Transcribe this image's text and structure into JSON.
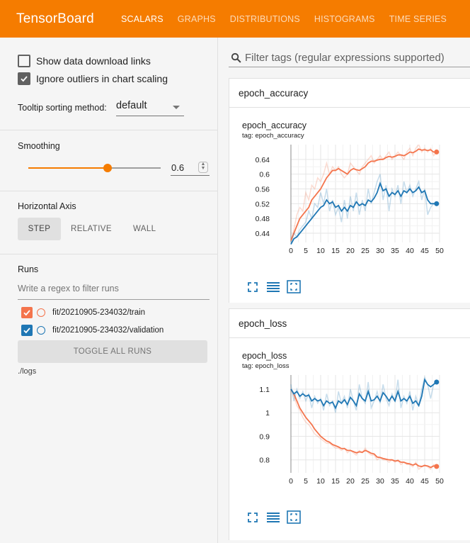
{
  "header": {
    "title": "TensorBoard",
    "tabs": [
      {
        "label": "SCALARS",
        "active": true
      },
      {
        "label": "GRAPHS",
        "active": false
      },
      {
        "label": "DISTRIBUTIONS",
        "active": false
      },
      {
        "label": "HISTOGRAMS",
        "active": false
      },
      {
        "label": "TIME SERIES",
        "active": false
      }
    ],
    "color": "#f57c00"
  },
  "sidebar": {
    "show_download": {
      "label": "Show data download links",
      "checked": false
    },
    "ignore_outliers": {
      "label": "Ignore outliers in chart scaling",
      "checked": true
    },
    "tooltip_sorting": {
      "label": "Tooltip sorting method:",
      "value": "default"
    },
    "smoothing": {
      "label": "Smoothing",
      "value": "0.6",
      "fraction": 0.6
    },
    "horizontal_axis": {
      "label": "Horizontal Axis",
      "options": [
        "STEP",
        "RELATIVE",
        "WALL"
      ],
      "selected": "STEP"
    },
    "runs": {
      "label": "Runs",
      "filter_placeholder": "Write a regex to filter runs",
      "items": [
        {
          "name": "fit/20210905-234032/train",
          "checked": true,
          "color": "#f4744c"
        },
        {
          "name": "fit/20210905-234032/validation",
          "checked": true,
          "color": "#1f77b4"
        }
      ],
      "toggle_label": "TOGGLE ALL RUNS",
      "logdir": "./logs"
    }
  },
  "main": {
    "filter_placeholder": "Filter tags (regular expressions supported)"
  },
  "chart_data": [
    {
      "type": "line",
      "group": "epoch_accuracy",
      "title": "epoch_accuracy",
      "subtitle": "tag: epoch_accuracy",
      "xlim": [
        0,
        50
      ],
      "ylim": [
        0.415,
        0.68
      ],
      "xticks": [
        "0",
        "5",
        "10",
        "15",
        "20",
        "25",
        "30",
        "35",
        "40",
        "45",
        "50"
      ],
      "yticks": [
        "0.44",
        "0.48",
        "0.52",
        "0.56",
        "0.6",
        "0.64"
      ],
      "ytick_values": [
        0.44,
        0.48,
        0.52,
        0.56,
        0.6,
        0.64
      ],
      "grid": true,
      "series": [
        {
          "color": "#f4744c",
          "x": [
            0,
            1,
            2,
            3,
            4,
            5,
            6,
            7,
            8,
            9,
            10,
            11,
            12,
            13,
            14,
            15,
            16,
            17,
            18,
            19,
            20,
            21,
            22,
            23,
            24,
            25,
            26,
            27,
            28,
            29,
            30,
            31,
            32,
            33,
            34,
            35,
            36,
            37,
            38,
            39,
            40,
            41,
            42,
            43,
            44,
            45,
            46,
            47,
            48,
            49
          ],
          "raw": [
            0.42,
            0.45,
            0.49,
            0.51,
            0.5,
            0.55,
            0.53,
            0.57,
            0.56,
            0.59,
            0.58,
            0.6,
            0.63,
            0.6,
            0.62,
            0.61,
            0.62,
            0.6,
            0.59,
            0.6,
            0.63,
            0.62,
            0.61,
            0.6,
            0.62,
            0.63,
            0.64,
            0.65,
            0.63,
            0.64,
            0.65,
            0.64,
            0.65,
            0.66,
            0.64,
            0.65,
            0.66,
            0.65,
            0.64,
            0.66,
            0.67,
            0.65,
            0.67,
            0.68,
            0.66,
            0.67,
            0.66,
            0.67,
            0.65,
            0.66
          ],
          "smoothed": [
            0.42,
            0.44,
            0.46,
            0.48,
            0.49,
            0.5,
            0.51,
            0.53,
            0.54,
            0.55,
            0.56,
            0.575,
            0.59,
            0.6,
            0.61,
            0.61,
            0.615,
            0.61,
            0.605,
            0.6,
            0.61,
            0.615,
            0.612,
            0.61,
            0.615,
            0.62,
            0.63,
            0.635,
            0.635,
            0.638,
            0.64,
            0.64,
            0.645,
            0.648,
            0.646,
            0.648,
            0.652,
            0.652,
            0.65,
            0.654,
            0.66,
            0.658,
            0.662,
            0.668,
            0.665,
            0.666,
            0.664,
            0.666,
            0.66,
            0.66
          ]
        },
        {
          "color": "#1f77b4",
          "x": [
            0,
            1,
            2,
            3,
            4,
            5,
            6,
            7,
            8,
            9,
            10,
            11,
            12,
            13,
            14,
            15,
            16,
            17,
            18,
            19,
            20,
            21,
            22,
            23,
            24,
            25,
            26,
            27,
            28,
            29,
            30,
            31,
            32,
            33,
            34,
            35,
            36,
            37,
            38,
            39,
            40,
            41,
            42,
            43,
            44,
            45,
            46,
            47,
            48,
            49
          ],
          "raw": [
            0.41,
            0.44,
            0.43,
            0.45,
            0.46,
            0.47,
            0.5,
            0.48,
            0.52,
            0.51,
            0.55,
            0.52,
            0.56,
            0.5,
            0.53,
            0.49,
            0.51,
            0.47,
            0.53,
            0.48,
            0.54,
            0.5,
            0.55,
            0.49,
            0.53,
            0.5,
            0.56,
            0.52,
            0.55,
            0.58,
            0.6,
            0.53,
            0.57,
            0.5,
            0.56,
            0.54,
            0.57,
            0.52,
            0.58,
            0.55,
            0.57,
            0.54,
            0.56,
            0.58,
            0.53,
            0.56,
            0.49,
            0.51,
            0.52,
            0.52
          ],
          "smoothed": [
            0.41,
            0.425,
            0.43,
            0.44,
            0.45,
            0.46,
            0.47,
            0.48,
            0.49,
            0.5,
            0.51,
            0.515,
            0.53,
            0.52,
            0.525,
            0.51,
            0.515,
            0.5,
            0.51,
            0.5,
            0.515,
            0.51,
            0.525,
            0.515,
            0.52,
            0.515,
            0.53,
            0.525,
            0.535,
            0.55,
            0.575,
            0.555,
            0.56,
            0.54,
            0.55,
            0.545,
            0.555,
            0.54,
            0.555,
            0.55,
            0.56,
            0.55,
            0.555,
            0.565,
            0.55,
            0.555,
            0.53,
            0.52,
            0.52,
            0.52
          ]
        }
      ]
    },
    {
      "type": "line",
      "group": "epoch_loss",
      "title": "epoch_loss",
      "subtitle": "tag: epoch_loss",
      "xlim": [
        0,
        50
      ],
      "ylim": [
        0.745,
        1.16
      ],
      "xticks": [
        "0",
        "5",
        "10",
        "15",
        "20",
        "25",
        "30",
        "35",
        "40",
        "45",
        "50"
      ],
      "yticks": [
        "0.8",
        "0.9",
        "1",
        "1.1"
      ],
      "ytick_values": [
        0.8,
        0.9,
        1.0,
        1.1
      ],
      "grid": true,
      "series": [
        {
          "color": "#f4744c",
          "x": [
            0,
            1,
            2,
            3,
            4,
            5,
            6,
            7,
            8,
            9,
            10,
            11,
            12,
            13,
            14,
            15,
            16,
            17,
            18,
            19,
            20,
            21,
            22,
            23,
            24,
            25,
            26,
            27,
            28,
            29,
            30,
            31,
            32,
            33,
            34,
            35,
            36,
            37,
            38,
            39,
            40,
            41,
            42,
            43,
            44,
            45,
            46,
            47,
            48,
            49
          ],
          "raw": [
            1.1,
            1.07,
            1.03,
            1.01,
            0.98,
            0.96,
            0.95,
            0.93,
            0.91,
            0.9,
            0.89,
            0.88,
            0.87,
            0.87,
            0.86,
            0.85,
            0.85,
            0.84,
            0.85,
            0.83,
            0.84,
            0.83,
            0.82,
            0.84,
            0.83,
            0.85,
            0.83,
            0.82,
            0.82,
            0.8,
            0.81,
            0.8,
            0.8,
            0.79,
            0.8,
            0.79,
            0.8,
            0.78,
            0.79,
            0.78,
            0.78,
            0.77,
            0.79,
            0.76,
            0.77,
            0.78,
            0.77,
            0.76,
            0.78,
            0.77
          ],
          "smoothed": [
            1.1,
            1.08,
            1.05,
            1.02,
            1.0,
            0.98,
            0.965,
            0.95,
            0.93,
            0.915,
            0.9,
            0.89,
            0.88,
            0.875,
            0.865,
            0.86,
            0.855,
            0.848,
            0.848,
            0.84,
            0.84,
            0.835,
            0.83,
            0.834,
            0.832,
            0.84,
            0.835,
            0.828,
            0.825,
            0.812,
            0.81,
            0.806,
            0.803,
            0.8,
            0.8,
            0.795,
            0.797,
            0.79,
            0.79,
            0.785,
            0.783,
            0.778,
            0.783,
            0.774,
            0.772,
            0.776,
            0.774,
            0.768,
            0.774,
            0.772
          ]
        },
        {
          "color": "#1f77b4",
          "x": [
            0,
            1,
            2,
            3,
            4,
            5,
            6,
            7,
            8,
            9,
            10,
            11,
            12,
            13,
            14,
            15,
            16,
            17,
            18,
            19,
            20,
            21,
            22,
            23,
            24,
            25,
            26,
            27,
            28,
            29,
            30,
            31,
            32,
            33,
            34,
            35,
            36,
            37,
            38,
            39,
            40,
            41,
            42,
            43,
            44,
            45,
            46,
            47,
            48,
            49
          ],
          "raw": [
            1.12,
            1.05,
            1.1,
            1.06,
            1.09,
            1.05,
            1.08,
            1.02,
            1.07,
            1.04,
            1.06,
            1.01,
            1.08,
            1.03,
            1.05,
            1.0,
            1.09,
            1.04,
            1.07,
            1.02,
            1.1,
            1.05,
            1.01,
            1.12,
            1.06,
            1.04,
            1.13,
            1.02,
            1.05,
            1.09,
            1.04,
            1.12,
            1.06,
            1.03,
            1.08,
            1.05,
            1.14,
            1.02,
            1.07,
            1.04,
            1.09,
            1.01,
            1.07,
            1.03,
            1.1,
            1.15,
            1.12,
            1.06,
            1.12,
            1.14
          ],
          "smoothed": [
            1.1,
            1.08,
            1.09,
            1.07,
            1.08,
            1.07,
            1.075,
            1.05,
            1.06,
            1.05,
            1.055,
            1.03,
            1.05,
            1.04,
            1.045,
            1.02,
            1.05,
            1.04,
            1.055,
            1.035,
            1.065,
            1.05,
            1.03,
            1.08,
            1.06,
            1.05,
            1.09,
            1.05,
            1.055,
            1.07,
            1.05,
            1.085,
            1.07,
            1.05,
            1.07,
            1.05,
            1.09,
            1.05,
            1.06,
            1.05,
            1.07,
            1.04,
            1.05,
            1.03,
            1.07,
            1.14,
            1.12,
            1.11,
            1.12,
            1.13
          ]
        }
      ]
    }
  ]
}
